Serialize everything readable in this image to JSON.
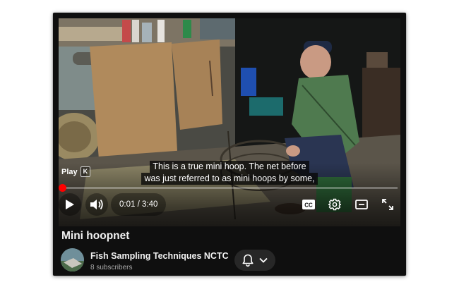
{
  "video": {
    "title": "Mini hoopnet",
    "captions": [
      "This is a true mini hoop. The net before",
      "was just referred to as mini hoops by some,"
    ],
    "play_hint": {
      "label": "Play",
      "shortcut": "K"
    },
    "time": {
      "current": "0:01",
      "separator": " / ",
      "duration": "3:40"
    },
    "progress_fraction": 0.0045,
    "icons": {
      "play": "play-icon",
      "volume": "volume-icon",
      "cc": "closed-captions-icon",
      "settings": "gear-icon",
      "theater": "theater-mode-icon",
      "fullscreen": "fullscreen-icon"
    },
    "cc_label": "CC"
  },
  "channel": {
    "name": "Fish Sampling Techniques NCTC",
    "subscribers": "8 subscribers",
    "icons": {
      "bell": "bell-icon",
      "dropdown": "chevron-down-icon"
    }
  },
  "colors": {
    "accent": "#ff0000",
    "background": "#0f0f0f",
    "text": "#f1f1f1",
    "muted_text": "#aaaaaa"
  }
}
